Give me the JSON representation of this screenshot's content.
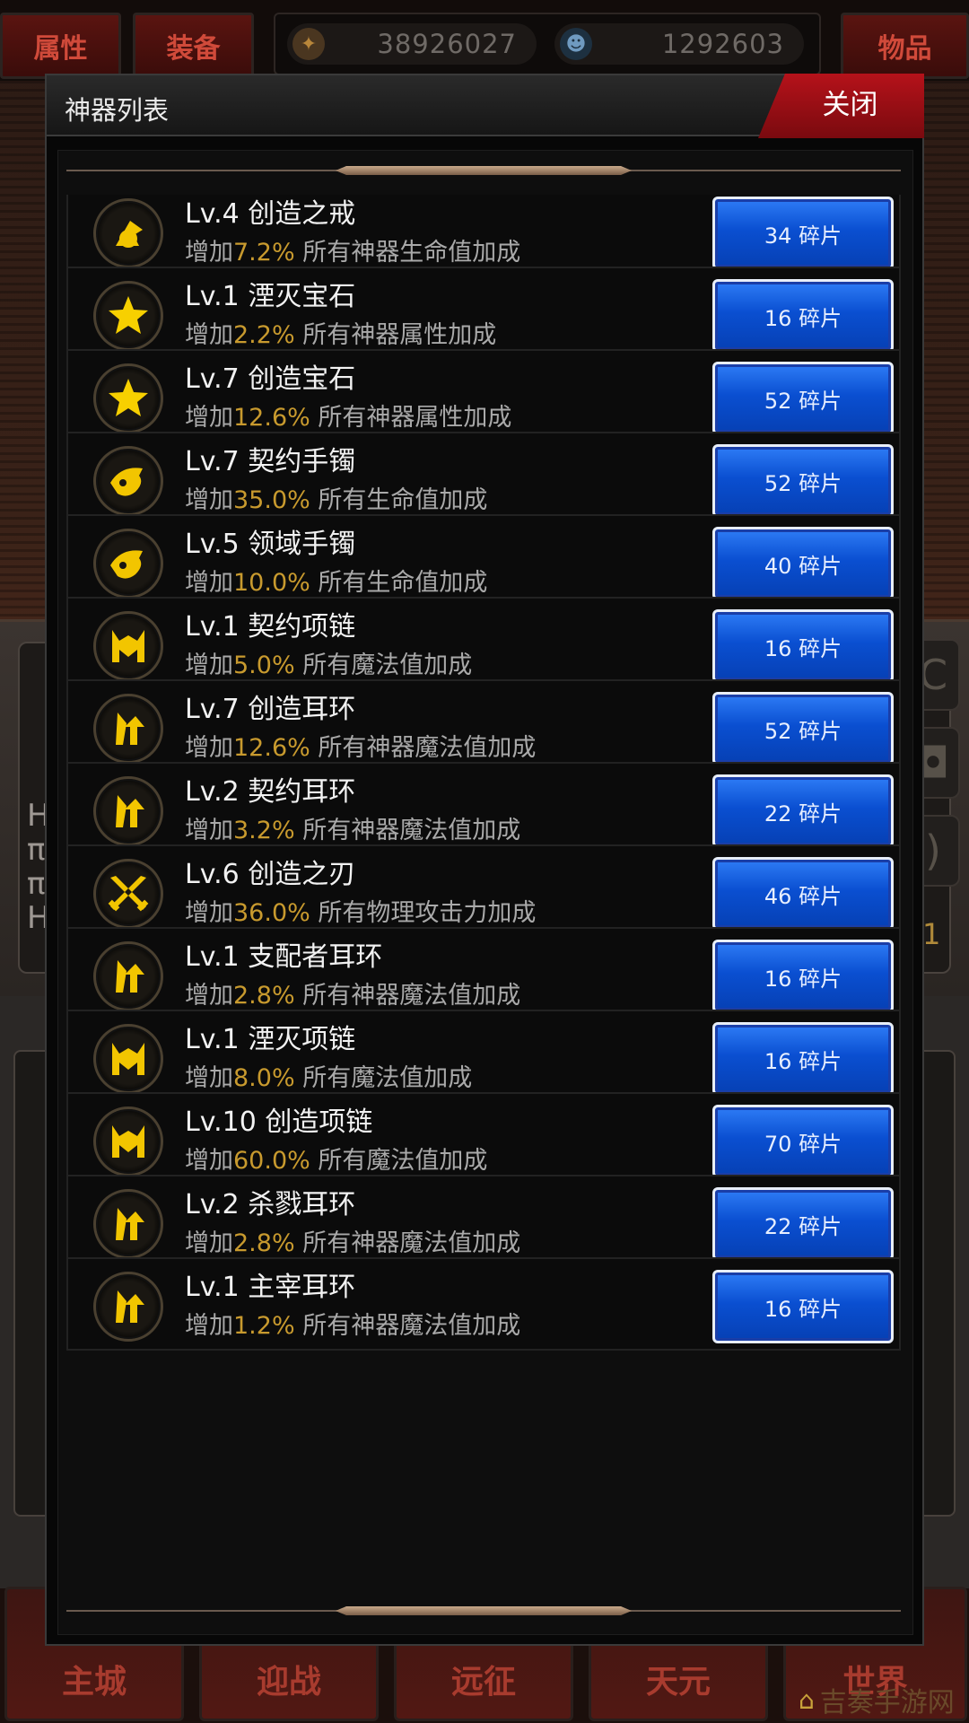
{
  "top_bar": {
    "tabs": [
      {
        "label": "属性"
      },
      {
        "label": "装备"
      },
      {
        "label": "物品"
      }
    ],
    "currencies": [
      {
        "icon": "gold-coin-icon",
        "value": "38926027"
      },
      {
        "icon": "skull-gem-icon",
        "value": "1292603"
      }
    ]
  },
  "modal": {
    "title": "神器列表",
    "close_label": "关闭",
    "items": [
      {
        "name": "Lv.4 创造之戒",
        "prefix": "增加",
        "percent": "7.2%",
        "effect": "所有神器生命值加成",
        "button": "34 碎片",
        "icon": "ring-icon"
      },
      {
        "name": "Lv.1 湮灭宝石",
        "prefix": "增加",
        "percent": "2.2%",
        "effect": "所有神器属性加成",
        "button": "16 碎片",
        "icon": "star-gem-icon"
      },
      {
        "name": "Lv.7 创造宝石",
        "prefix": "增加",
        "percent": "12.6%",
        "effect": "所有神器属性加成",
        "button": "52 碎片",
        "icon": "star-gem-icon"
      },
      {
        "name": "Lv.7 契约手镯",
        "prefix": "增加",
        "percent": "35.0%",
        "effect": "所有生命值加成",
        "button": "52 碎片",
        "icon": "bracelet-icon"
      },
      {
        "name": "Lv.5 领域手镯",
        "prefix": "增加",
        "percent": "10.0%",
        "effect": "所有生命值加成",
        "button": "40 碎片",
        "icon": "bracelet-icon"
      },
      {
        "name": "Lv.1 契约项链",
        "prefix": "增加",
        "percent": "5.0%",
        "effect": "所有魔法值加成",
        "button": "16 碎片",
        "icon": "necklace-icon"
      },
      {
        "name": "Lv.7 创造耳环",
        "prefix": "增加",
        "percent": "12.6%",
        "effect": "所有神器魔法值加成",
        "button": "52 碎片",
        "icon": "earring-icon"
      },
      {
        "name": "Lv.2 契约耳环",
        "prefix": "增加",
        "percent": "3.2%",
        "effect": "所有神器魔法值加成",
        "button": "22 碎片",
        "icon": "earring-icon"
      },
      {
        "name": "Lv.6 创造之刃",
        "prefix": "增加",
        "percent": "36.0%",
        "effect": "所有物理攻击力加成",
        "button": "46 碎片",
        "icon": "crossed-swords-icon"
      },
      {
        "name": "Lv.1 支配者耳环",
        "prefix": "增加",
        "percent": "2.8%",
        "effect": "所有神器魔法值加成",
        "button": "16 碎片",
        "icon": "earring-icon"
      },
      {
        "name": "Lv.1 湮灭项链",
        "prefix": "增加",
        "percent": "8.0%",
        "effect": "所有魔法值加成",
        "button": "16 碎片",
        "icon": "necklace-icon"
      },
      {
        "name": "Lv.10 创造项链",
        "prefix": "增加",
        "percent": "60.0%",
        "effect": "所有魔法值加成",
        "button": "70 碎片",
        "icon": "necklace-icon"
      },
      {
        "name": "Lv.2 杀戮耳环",
        "prefix": "增加",
        "percent": "2.8%",
        "effect": "所有神器魔法值加成",
        "button": "22 碎片",
        "icon": "earring-icon"
      },
      {
        "name": "Lv.1 主宰耳环",
        "prefix": "增加",
        "percent": "1.2%",
        "effect": "所有神器魔法值加成",
        "button": "16 碎片",
        "icon": "earring-icon"
      }
    ]
  },
  "bottom_nav": {
    "items": [
      {
        "label": "主城"
      },
      {
        "label": "迎战"
      },
      {
        "label": "远征"
      },
      {
        "label": "天元"
      },
      {
        "label": "世界"
      }
    ]
  },
  "watermark": "吉奏手游网",
  "colors": {
    "accent_gold": "#c89a2e",
    "button_blue": "#0a4fd1",
    "close_red": "#b5121a"
  }
}
